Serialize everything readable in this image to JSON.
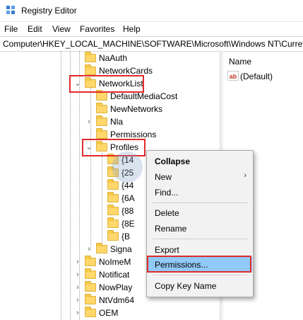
{
  "window": {
    "title": "Registry Editor"
  },
  "menu": [
    "File",
    "Edit",
    "View",
    "Favorites",
    "Help"
  ],
  "address": "Computer\\HKEY_LOCAL_MACHINE\\SOFTWARE\\Microsoft\\Windows NT\\CurrentVersion\\NetworkList\\Profiles",
  "tree": {
    "naauth": "NaAuth",
    "networkcards": "NetworkCards",
    "networklist": "NetworkList",
    "defaultmediacost": "DefaultMediaCost",
    "newnetworks": "NewNetworks",
    "nla": "Nla",
    "permissions": "Permissions",
    "profiles": "Profiles",
    "profile_children": [
      "{14",
      "{25",
      "{44",
      "{6A",
      "{88",
      "{8E",
      "{B"
    ],
    "signatures": "Signa",
    "noimemode": "NoImeM",
    "notifications": "Notificat",
    "nowplaying": "NowPlay",
    "ntvdm64": "NtVdm64",
    "oem": "OEM"
  },
  "values_pane": {
    "column_name": "Name",
    "default_value": "(Default)",
    "value_icon_text": "ab"
  },
  "context_menu": {
    "collapse": "Collapse",
    "new": "New",
    "new_arrow": "›",
    "find": "Find...",
    "delete": "Delete",
    "rename": "Rename",
    "export": "Export",
    "permissions": "Permissions...",
    "copy_key_name": "Copy Key Name"
  },
  "colors": {
    "highlight_box": "#e02b2b",
    "menu_selected": "#91c9f7",
    "folder": "#ffd76b"
  }
}
